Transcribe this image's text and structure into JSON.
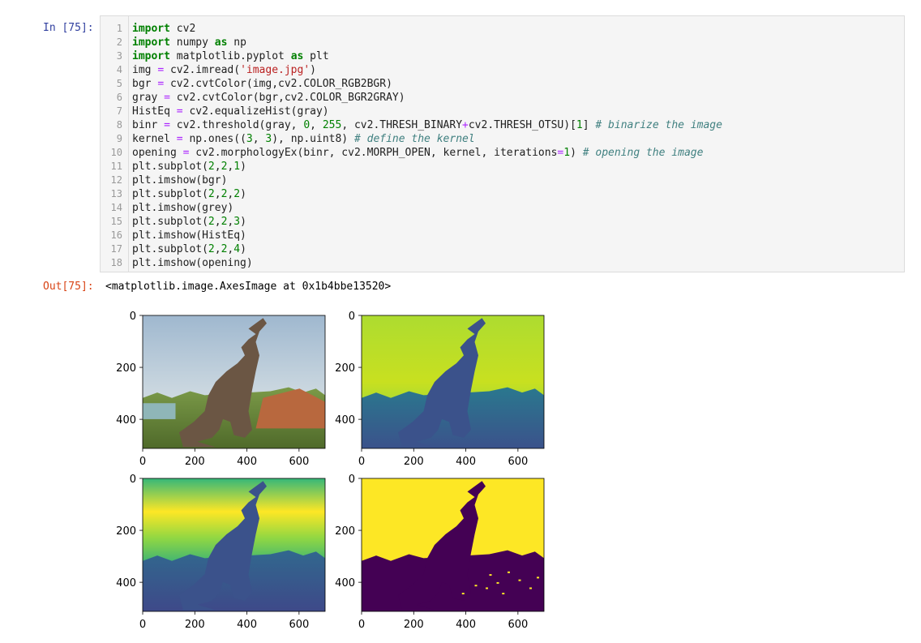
{
  "cell": {
    "in_prompt": "In [75]:",
    "out_prompt": "Out[75]:",
    "output_text": "<matplotlib.image.AxesImage at 0x1b4bbe13520>",
    "lines": [
      {
        "n": "1",
        "html": "<span class=\"kw\">import</span> cv2"
      },
      {
        "n": "2",
        "html": "<span class=\"kw\">import</span> numpy <span class=\"kw\">as</span> np"
      },
      {
        "n": "3",
        "html": "<span class=\"kw\">import</span> matplotlib.pyplot <span class=\"kw\">as</span> plt"
      },
      {
        "n": "4",
        "html": "img <span class=\"op\">=</span> cv2.imread(<span class=\"str\">'image.jpg'</span>)"
      },
      {
        "n": "5",
        "html": "bgr <span class=\"op\">=</span> cv2.cvtColor(img,cv2.COLOR_RGB2BGR)"
      },
      {
        "n": "6",
        "html": "gray <span class=\"op\">=</span> cv2.cvtColor(bgr,cv2.COLOR_BGR2GRAY)"
      },
      {
        "n": "7",
        "html": "HistEq <span class=\"op\">=</span> cv2.equalizeHist(gray)"
      },
      {
        "n": "8",
        "html": "binr <span class=\"op\">=</span> cv2.threshold(gray, <span class=\"num\">0</span>, <span class=\"num\">255</span>, cv2.THRESH_BINARY<span class=\"op\">+</span>cv2.THRESH_OTSU)[<span class=\"num\">1</span>] <span class=\"cm\"># binarize the image</span>"
      },
      {
        "n": "9",
        "html": "kernel <span class=\"op\">=</span> np.ones((<span class=\"num\">3</span>, <span class=\"num\">3</span>), np.uint8) <span class=\"cm\"># define the kernel</span>"
      },
      {
        "n": "10",
        "html": "opening <span class=\"op\">=</span> cv2.morphologyEx(binr, cv2.MORPH_OPEN, kernel, iterations<span class=\"op\">=</span><span class=\"num\">1</span>) <span class=\"cm\"># opening the image</span>"
      },
      {
        "n": "11",
        "html": "plt.subplot(<span class=\"num\">2</span>,<span class=\"num\">2</span>,<span class=\"num\">1</span>)"
      },
      {
        "n": "12",
        "html": "plt.imshow(bgr)"
      },
      {
        "n": "13",
        "html": "plt.subplot(<span class=\"num\">2</span>,<span class=\"num\">2</span>,<span class=\"num\">2</span>)"
      },
      {
        "n": "14",
        "html": "plt.imshow(grey)"
      },
      {
        "n": "15",
        "html": "plt.subplot(<span class=\"num\">2</span>,<span class=\"num\">2</span>,<span class=\"num\">3</span>)"
      },
      {
        "n": "16",
        "html": "plt.imshow(HistEq)"
      },
      {
        "n": "17",
        "html": "plt.subplot(<span class=\"num\">2</span>,<span class=\"num\">2</span>,<span class=\"num\">4</span>)"
      },
      {
        "n": "18",
        "html": "plt.imshow(opening)"
      }
    ]
  },
  "figure": {
    "x_ticks": [
      "0",
      "200",
      "400",
      "600"
    ],
    "y_ticks": [
      "0",
      "200",
      "400"
    ],
    "panels": [
      {
        "name": "bgr-image-panel",
        "style": "photo"
      },
      {
        "name": "gray-viridis-panel",
        "style": "viridis-gray"
      },
      {
        "name": "histeq-viridis-panel",
        "style": "viridis-eq"
      },
      {
        "name": "opening-binary-panel",
        "style": "binary"
      }
    ],
    "colors": {
      "viridis_dark": "#440154",
      "viridis_teal": "#21918c",
      "viridis_green": "#5ec962",
      "viridis_yellow": "#fde725"
    }
  }
}
